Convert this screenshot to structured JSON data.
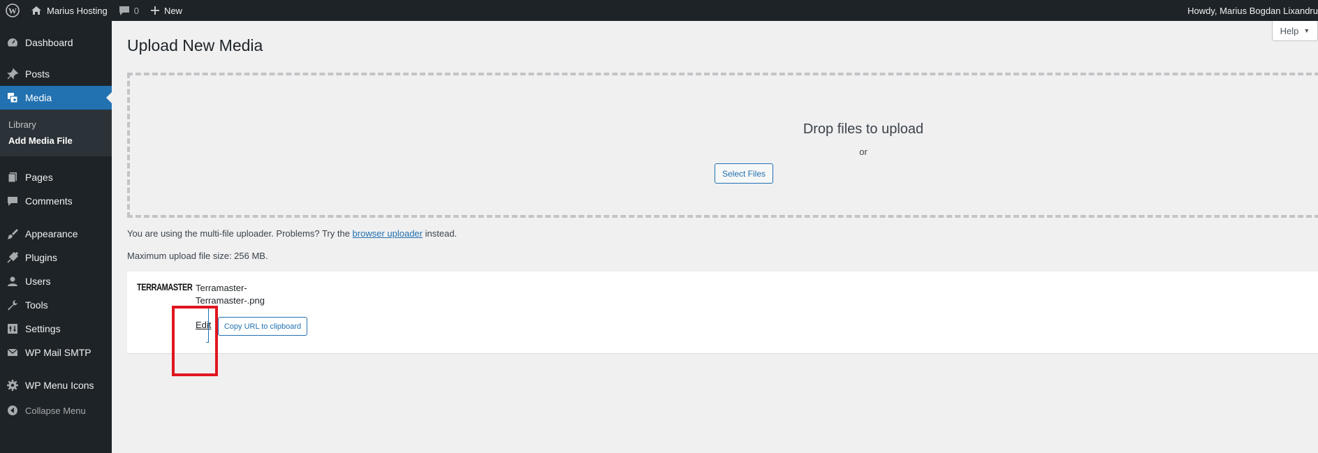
{
  "adminbar": {
    "site_name": "Marius Hosting",
    "comments_count": "0",
    "new_label": "New",
    "howdy": "Howdy, Marius Bogdan Lixandru"
  },
  "sidebar": {
    "items": [
      {
        "label": "Dashboard",
        "icon": "dashboard-icon"
      },
      {
        "label": "Posts",
        "icon": "pin-icon"
      },
      {
        "label": "Media",
        "icon": "media-icon"
      },
      {
        "label": "Pages",
        "icon": "pages-icon"
      },
      {
        "label": "Comments",
        "icon": "comment-icon"
      },
      {
        "label": "Appearance",
        "icon": "paintbrush-icon"
      },
      {
        "label": "Plugins",
        "icon": "plug-icon"
      },
      {
        "label": "Users",
        "icon": "user-icon"
      },
      {
        "label": "Tools",
        "icon": "wrench-icon"
      },
      {
        "label": "Settings",
        "icon": "settings-icon"
      },
      {
        "label": "WP Mail SMTP",
        "icon": "mail-icon"
      },
      {
        "label": "WP Menu Icons",
        "icon": "gear-icon"
      }
    ],
    "submenu": [
      "Library",
      "Add Media File"
    ],
    "collapse_label": "Collapse Menu"
  },
  "main": {
    "title": "Upload New Media",
    "help_label": "Help",
    "drop_title": "Drop files to upload",
    "drop_or": "or",
    "select_files": "Select Files",
    "uploader_prefix": "You are using the multi-file uploader. Problems? Try the",
    "uploader_link": "browser uploader",
    "uploader_suffix": "instead.",
    "max_size": "Maximum upload file size: 256 MB.",
    "item": {
      "thumb_text": "TERRAMASTER",
      "title": "Terramaster-",
      "filename": "Terramaster-.png",
      "edit_label": "Edit",
      "copy_label": "Copy URL to clipboard"
    }
  },
  "colors": {
    "accent": "#2271b1",
    "sidebar_bg": "#1d2327",
    "highlight": "#e0161f"
  }
}
